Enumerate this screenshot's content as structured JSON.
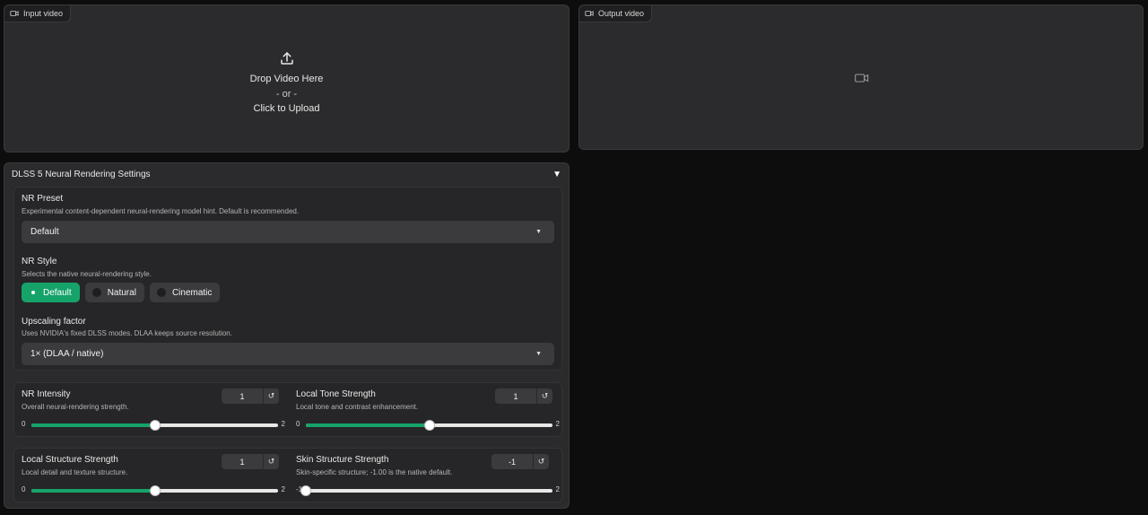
{
  "input_video": {
    "tag_label": "Input video",
    "drop_text": "Drop Video Here",
    "or_text": "- or -",
    "click_text": "Click to Upload"
  },
  "output_video": {
    "tag_label": "Output video"
  },
  "settings": {
    "title": "DLSS 5 Neural Rendering Settings",
    "nr_preset": {
      "label": "NR Preset",
      "info": "Experimental content-dependent neural-rendering model hint. Default is recommended.",
      "value": "Default"
    },
    "nr_style": {
      "label": "NR Style",
      "info": "Selects the native neural-rendering style.",
      "options": [
        "Default",
        "Natural",
        "Cinematic"
      ],
      "selected": "Default"
    },
    "upscaling": {
      "label": "Upscaling factor",
      "info": "Uses NVIDIA's fixed DLSS modes. DLAA keeps source resolution.",
      "value": "1× (DLAA / native)"
    },
    "sliders": [
      {
        "label": "NR Intensity",
        "info": "Overall neural-rendering strength.",
        "value": "1",
        "min": "0",
        "max": "2",
        "fraction": 0.5
      },
      {
        "label": "Local Tone Strength",
        "info": "Local tone and contrast enhancement.",
        "value": "1",
        "min": "0",
        "max": "2",
        "fraction": 0.5
      },
      {
        "label": "Local Structure Strength",
        "info": "Local detail and texture structure.",
        "value": "1",
        "min": "0",
        "max": "2",
        "fraction": 0.5
      },
      {
        "label": "Skin Structure Strength",
        "info": "Skin-specific structure; -1.00 is the native default.",
        "value": "-1",
        "min": "-1",
        "max": "2",
        "fraction": 0.0
      }
    ]
  },
  "colors": {
    "accent": "#16a36a",
    "panel": "#2b2b2d",
    "background": "#0d0d0d"
  }
}
